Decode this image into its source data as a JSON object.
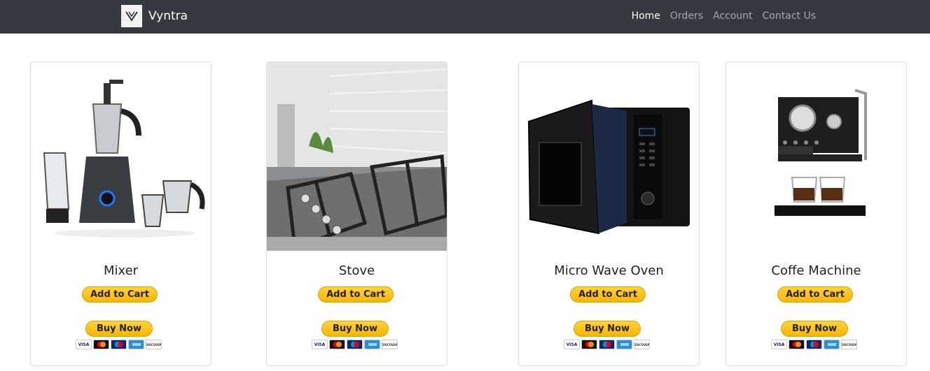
{
  "app": {
    "brand": "Vyntra"
  },
  "nav": {
    "items": [
      {
        "label": "Home",
        "active": true
      },
      {
        "label": "Orders",
        "active": false
      },
      {
        "label": "Account",
        "active": false
      },
      {
        "label": "Contact Us",
        "active": false
      }
    ]
  },
  "products": [
    {
      "name": "Mixer",
      "image_icon": "mixer-grinder-image",
      "add_to_cart": "Add to Cart",
      "buy_now": "Buy Now"
    },
    {
      "name": "Stove",
      "image_icon": "gas-stove-image",
      "add_to_cart": "Add to Cart",
      "buy_now": "Buy Now"
    },
    {
      "name": "Micro Wave Oven",
      "image_icon": "microwave-oven-image",
      "add_to_cart": "Add to Cart",
      "buy_now": "Buy Now"
    },
    {
      "name": "Coffe Machine",
      "image_icon": "coffee-machine-image",
      "add_to_cart": "Add to Cart",
      "buy_now": "Buy Now"
    }
  ],
  "payment_cards": {
    "visa": "VISA",
    "discover": "DISCOVER"
  },
  "colors": {
    "navbar": "#343a40",
    "button": "#ffc439"
  }
}
